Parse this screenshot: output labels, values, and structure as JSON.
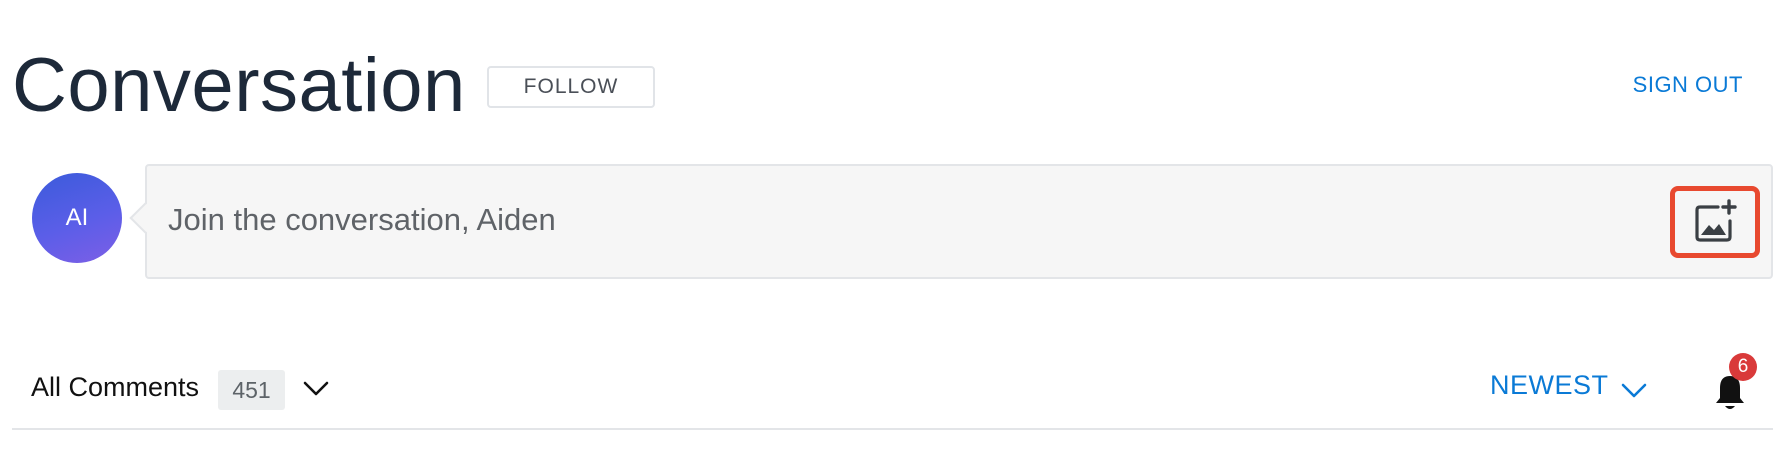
{
  "header": {
    "title": "Conversation",
    "follow_label": "FOLLOW",
    "sign_out_label": "SIGN OUT"
  },
  "composer": {
    "avatar_initials": "AI",
    "placeholder": "Join the conversation, Aiden",
    "image_button_icon": "add-image-icon",
    "highlight_color": "#e8492f"
  },
  "comments_bar": {
    "label": "All Comments",
    "count": "451",
    "sort_label": "NEWEST",
    "notification_count": "6"
  },
  "colors": {
    "accent": "#0a7ad6",
    "avatar_gradient_start": "#3b5bdb",
    "avatar_gradient_end": "#7d5fe6",
    "notification_badge": "#d93a3a"
  }
}
